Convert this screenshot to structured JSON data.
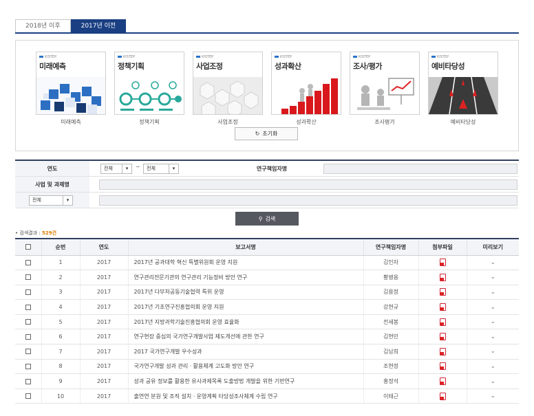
{
  "tabs": [
    {
      "label": "2018년 이후",
      "active": false
    },
    {
      "label": "2017년 이전",
      "active": true
    }
  ],
  "categories": [
    {
      "logo": "KISTEP",
      "title": "미래예측",
      "caption": "미래예측"
    },
    {
      "logo": "KISTEP",
      "title": "정책기획",
      "caption": "정책기획"
    },
    {
      "logo": "KISTEP",
      "title": "사업조정",
      "caption": "사업조정"
    },
    {
      "logo": "KISTEP",
      "title": "성과확산",
      "caption": "성과확산"
    },
    {
      "logo": "KISTEP",
      "title": "조사/평가",
      "caption": "조사평가"
    },
    {
      "logo": "KISTEP",
      "title": "예비타당성",
      "caption": "예비타당성"
    }
  ],
  "reset_label": "초기화",
  "search": {
    "year_label": "연도",
    "year_from": "전체",
    "year_sep": "~",
    "year_to": "전체",
    "researcher_label": "연구책임자명",
    "project_label": "사업 및 과제명",
    "scope_select": "전체",
    "button_label": "검색"
  },
  "result": {
    "prefix": "검색결과 : ",
    "count": "529건"
  },
  "table": {
    "headers": [
      "",
      "순번",
      "연도",
      "보고서명",
      "연구책임자명",
      "첨부파일",
      "미리보기"
    ],
    "rows": [
      {
        "no": "1",
        "year": "2017",
        "title": "2017년 공과대학 혁신 특별위원회 운영 지원",
        "researcher": "김인자"
      },
      {
        "no": "2",
        "year": "2017",
        "title": "연구관리전문기관의 연구관리 기능정비 방안 연구",
        "researcher": "황병용"
      },
      {
        "no": "3",
        "year": "2017",
        "title": "2017년 다부처공동기술협력 특위 운영",
        "researcher": "김용정"
      },
      {
        "no": "4",
        "year": "2017",
        "title": "2017년 기초연구진흥협의회 운영 지원",
        "researcher": "강현규"
      },
      {
        "no": "5",
        "year": "2017",
        "title": "2017년 지방과학기술진흥협의회 운영 효율화",
        "researcher": "전세봉"
      },
      {
        "no": "6",
        "year": "2017",
        "title": "연구현장 중심의 국가연구개발사업 제도개선에 관한 연구",
        "researcher": "김현민"
      },
      {
        "no": "7",
        "year": "2017",
        "title": "2017 국가연구개발 우수성과",
        "researcher": "김남희"
      },
      {
        "no": "8",
        "year": "2017",
        "title": "국가연구개발 성과 관리ㆍ활용체계 고도화 방안 연구",
        "researcher": "조현정"
      },
      {
        "no": "9",
        "year": "2017",
        "title": "성과 공유 정보를 활용한 유사과제목록 도출방법 개발을 위한 기반연구",
        "researcher": "홍정석"
      },
      {
        "no": "10",
        "year": "2017",
        "title": "출연연 분원 및 조직 설치ㆍ운영계획 타당성조사체계 수립 연구",
        "researcher": "이태근"
      }
    ]
  },
  "colors": {
    "primary": "#1a3f82",
    "header_border": "#2f3f5f",
    "count": "#e07a00",
    "pdf": "#d22222"
  },
  "icons": {
    "reset": "refresh-icon",
    "search": "search-icon",
    "attachment": "pdf-icon",
    "preview": "chevron-down-icon"
  }
}
